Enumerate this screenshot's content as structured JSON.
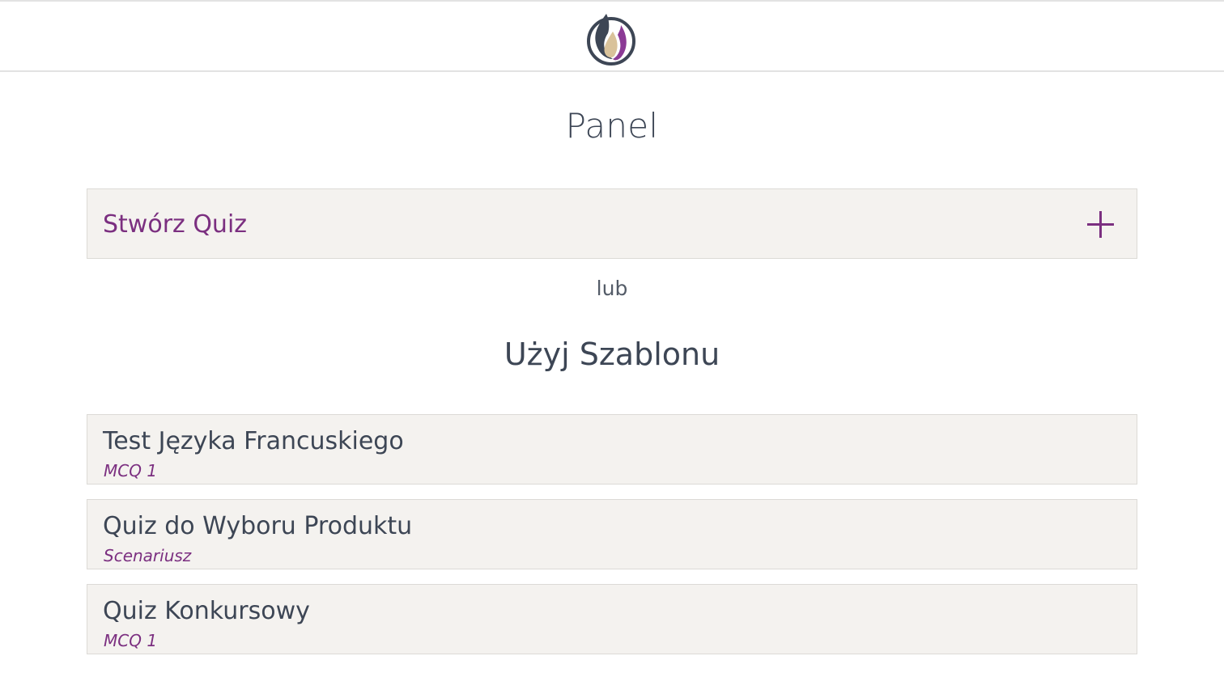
{
  "header": {
    "logo_icon": "flame-logo-icon",
    "colors": {
      "dark": "#3d4655",
      "purple": "#8b3a95",
      "gold": "#d9c29a"
    }
  },
  "page_title": "Panel",
  "create_quiz": {
    "label": "Stwórz Quiz",
    "icon": "plus-icon"
  },
  "or_text": "lub",
  "templates_title": "Użyj Szablonu",
  "templates": [
    {
      "name": "Test Języka Francuskiego",
      "type": "MCQ 1"
    },
    {
      "name": "Quiz do Wyboru Produktu",
      "type": "Scenariusz"
    },
    {
      "name": "Quiz Konkursowy",
      "type": "MCQ 1"
    }
  ],
  "colors": {
    "accent": "#7b2f80",
    "text": "#3d4655",
    "card_bg": "#f4f2ef",
    "card_border": "#dcdad6"
  }
}
